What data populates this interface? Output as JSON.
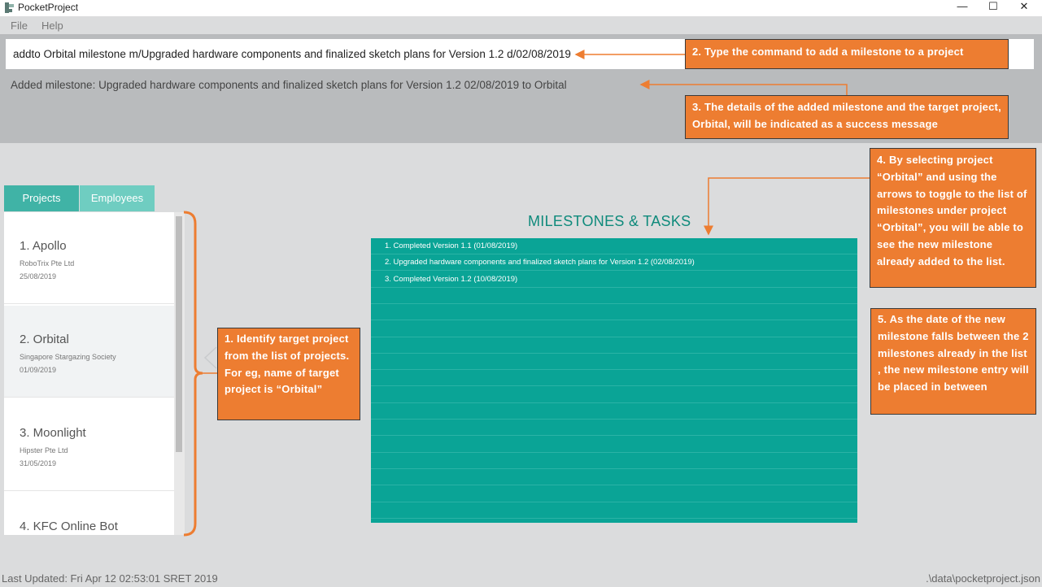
{
  "window": {
    "title": "PocketProject",
    "minimize_glyph": "—",
    "maximize_glyph": "☐",
    "close_glyph": "✕"
  },
  "menu": {
    "file": "File",
    "help": "Help"
  },
  "command": {
    "input_value": "addto Orbital milestone m/Upgraded hardware components and finalized sketch plans for Version 1.2 d/02/08/2019",
    "result": "Added milestone: Upgraded hardware components and finalized sketch plans for Version 1.2 02/08/2019 to Orbital"
  },
  "tabs": {
    "projects": "Projects",
    "employees": "Employees"
  },
  "projects": [
    {
      "name": "1.  Apollo",
      "client": "RoboTrix Pte Ltd",
      "date": "25/08/2019"
    },
    {
      "name": "2.  Orbital",
      "client": "Singapore Stargazing Society",
      "date": "01/09/2019"
    },
    {
      "name": "3.  Moonlight",
      "client": "Hipster Pte Ltd",
      "date": "31/05/2019"
    },
    {
      "name": "4.  KFC Online Bot",
      "client": "",
      "date": ""
    }
  ],
  "milestones": {
    "heading": "MILESTONES & TASKS",
    "items": [
      "1. Completed Version 1.1 (01/08/2019)",
      "2. Upgraded hardware components and finalized sketch plans for Version 1.2 (02/08/2019)",
      "3. Completed Version 1.2 (10/08/2019)"
    ],
    "empty_rows": 14
  },
  "annotations": {
    "step1": "1. Identify target project from the list of projects.  For eg, name of target project is “Orbital”",
    "step2": "2. Type the command to add a milestone to a project",
    "step3": "3. The details of the added milestone and the target project, Orbital, will be indicated as a success message",
    "step4": "4. By selecting project “Orbital” and using the arrows to toggle to the list of milestones under project “Orbital”, you will be able to see the new milestone already added to the list.",
    "step5": "5. As the date of the new milestone falls between the 2 milestones already in the list , the new milestone entry will be placed in between"
  },
  "status": {
    "last_updated": "Last Updated: Fri Apr 12 02:53:01 SRET 2019",
    "file_path": ".\\data\\pocketproject.json"
  },
  "colors": {
    "accent_teal": "#0aa496",
    "tab_active": "#40b3a6",
    "tab_inactive": "#6fcdc1",
    "callout_orange": "#ed7d31"
  }
}
